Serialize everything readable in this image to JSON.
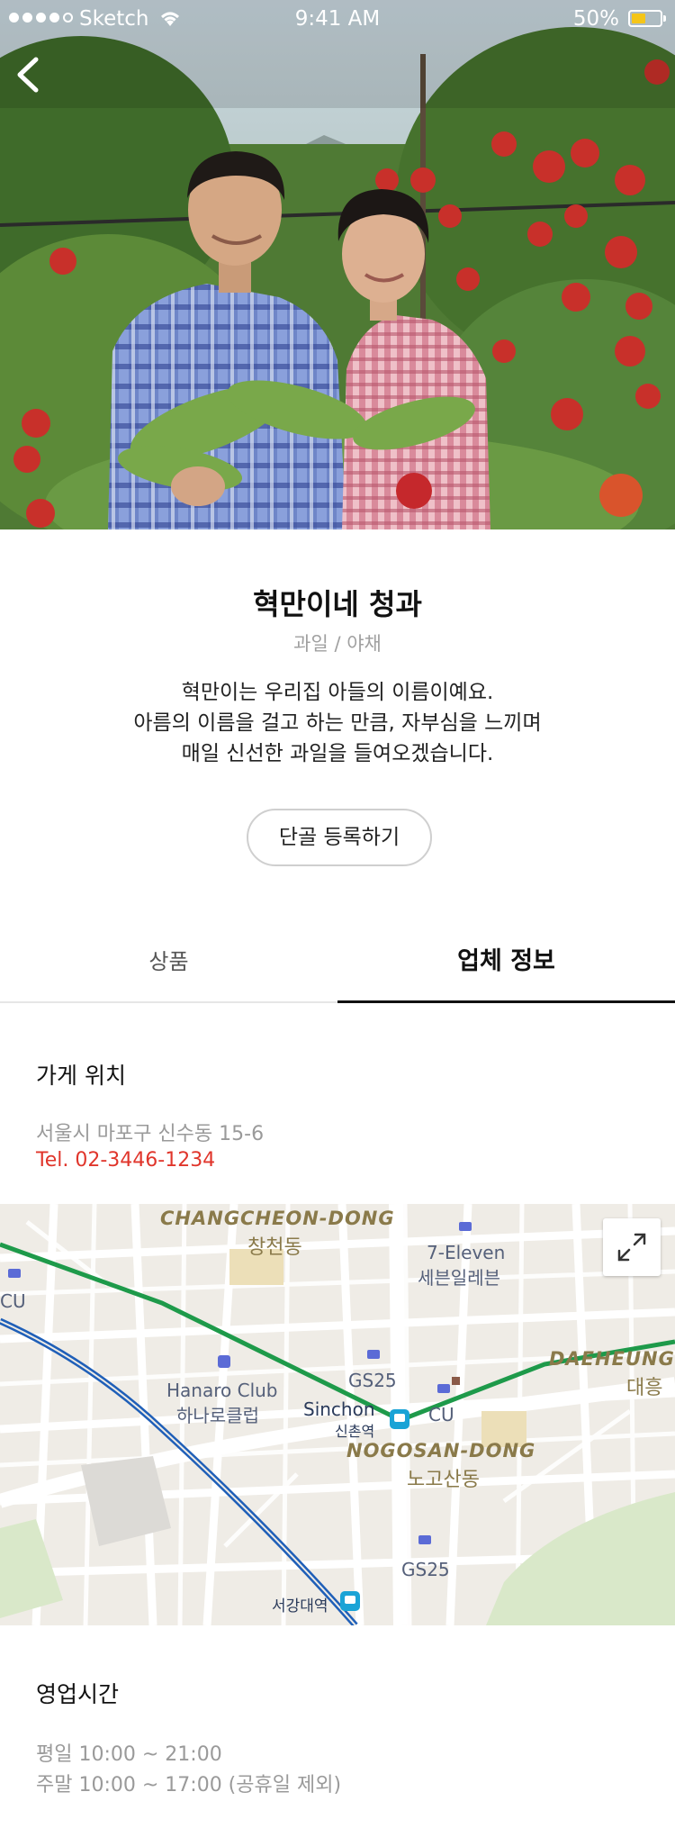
{
  "status_bar": {
    "carrier": "Sketch",
    "time": "9:41 AM",
    "battery": "50%",
    "battery_level": 0.5
  },
  "store": {
    "name": "혁만이네 청과",
    "category": "과일 / 야채",
    "description": [
      "혁만이는 우리집 아들의 이름이예요.",
      "아름의 이름을 걸고 하는 만큼, 자부심을 느끼며",
      "매일 신선한 과일을 들여오겠습니다."
    ],
    "regular_button": "단골 등록하기"
  },
  "tabs": [
    {
      "label": "상품",
      "active": false
    },
    {
      "label": "업체 정보",
      "active": true
    }
  ],
  "location": {
    "title": "가게 위치",
    "address": "서울시 마포구 신수동 15-6",
    "phone": "Tel. 02-3446-1234"
  },
  "map": {
    "labels": {
      "changcheon_en": "CHANGCHEON-DONG",
      "changcheon_ko": "창천동",
      "seven_eleven_en": "7-Eleven",
      "seven_eleven_ko": "세븐일레븐",
      "cu_left": "CU",
      "gs25_top": "GS25",
      "hanaro_en": "Hanaro Club",
      "hanaro_ko": "하나로클럽",
      "sinchon_en": "Sinchon",
      "sinchon_ko": "신촌역",
      "cu_center": "CU",
      "daeheung_en": "DAEHEUNG",
      "daeheung_ko": "대흥",
      "nogosan_en": "NOGOSAN-DONG",
      "nogosan_ko": "노고산동",
      "gs25_bottom": "GS25",
      "sogang_ko": "서강대역"
    },
    "colors": {
      "land": "#efece6",
      "park": "#d9e8c9",
      "line2_green": "#1e9a4a",
      "gyeongui_blue": "#1f5fb8",
      "district_label": "#8a7a4a",
      "poi_icon": "#5b6bd6"
    }
  },
  "hours": {
    "title": "영업시간",
    "weekday": "평일 10:00 ~ 21:00",
    "weekend": "주말 10:00 ~ 17:00 (공휴일 제외)"
  }
}
